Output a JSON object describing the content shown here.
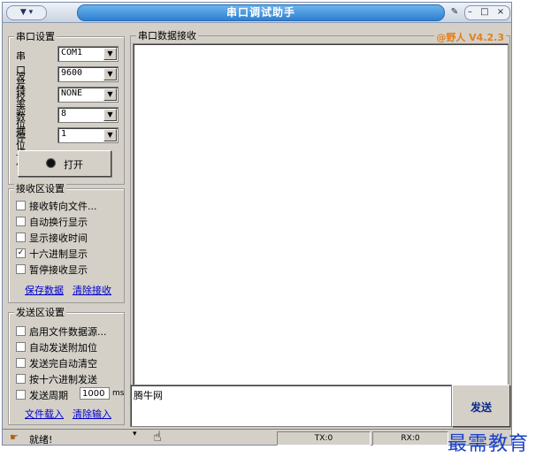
{
  "window": {
    "title": "串口调试助手",
    "sys_menu": "▼ ▾",
    "pin_icon": "pin-icon",
    "controls": "– □ ×"
  },
  "port_settings": {
    "group_label": "串口设置",
    "fields": [
      {
        "label": "串口号",
        "value": "COM1"
      },
      {
        "label": "波特率",
        "value": "9600"
      },
      {
        "label": "校验位",
        "value": "NONE"
      },
      {
        "label": "数据位",
        "value": "8"
      },
      {
        "label": "停止位",
        "value": "1"
      }
    ],
    "open_button": "打开"
  },
  "recv_settings": {
    "group_label": "接收区设置",
    "options": [
      {
        "label": "接收转向文件...",
        "checked": false
      },
      {
        "label": "自动换行显示",
        "checked": false
      },
      {
        "label": "显示接收时间",
        "checked": false
      },
      {
        "label": "十六进制显示",
        "checked": true
      },
      {
        "label": "暂停接收显示",
        "checked": false
      }
    ],
    "save_link": "保存数据",
    "clear_link": "清除接收"
  },
  "send_settings": {
    "group_label": "发送区设置",
    "options": [
      {
        "label": "启用文件数据源...",
        "checked": false
      },
      {
        "label": "自动发送附加位",
        "checked": false
      },
      {
        "label": "发送完自动清空",
        "checked": false
      },
      {
        "label": "按十六进制发送",
        "checked": false
      }
    ],
    "period_label": "发送周期",
    "period_value": "1000",
    "period_unit": "ms",
    "load_link": "文件载入",
    "clear_link": "清除输入"
  },
  "receive_panel": {
    "label": "串口数据接收",
    "version": "@野人 V4.2.3"
  },
  "send_panel": {
    "text": "腾牛网",
    "send_button": "发送"
  },
  "status_bar": {
    "status_text": "就绪!",
    "tx": "TX:0",
    "rx": "RX:0"
  },
  "watermark": "最需教育"
}
